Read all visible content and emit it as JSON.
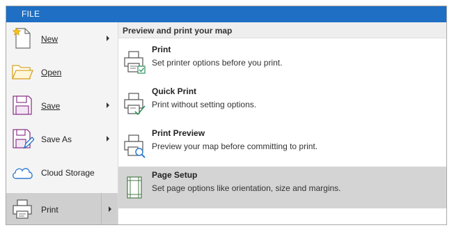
{
  "header": {
    "file_tab": "FILE"
  },
  "sidebar": {
    "items": [
      {
        "label": "New",
        "icon": "new-document-icon",
        "has_submenu": true
      },
      {
        "label": "Open",
        "icon": "open-folder-icon",
        "has_submenu": false
      },
      {
        "label": "Save",
        "icon": "save-disk-icon",
        "has_submenu": true
      },
      {
        "label": "Save As",
        "icon": "save-as-icon",
        "has_submenu": true
      },
      {
        "label": "Cloud Storage",
        "icon": "cloud-icon",
        "has_submenu": false
      },
      {
        "label": "Print",
        "icon": "printer-icon",
        "has_submenu": true,
        "selected": true
      }
    ]
  },
  "panel": {
    "header": "Preview and print your map",
    "options": [
      {
        "title": "Print",
        "description": "Set printer options before you print.",
        "icon": "print-options-icon"
      },
      {
        "title": "Quick Print",
        "description": "Print without setting options.",
        "icon": "quick-print-icon"
      },
      {
        "title": "Print Preview",
        "description": "Preview your map before committing to print.",
        "icon": "print-preview-icon"
      },
      {
        "title": "Page Setup",
        "description": "Set page options like orientation, size and margins.",
        "icon": "page-setup-icon",
        "selected": true
      }
    ]
  },
  "colors": {
    "accent": "#1f6fc4",
    "selected_bg": "#d4d4d4",
    "sidebar_bg": "#f4f4f4"
  }
}
